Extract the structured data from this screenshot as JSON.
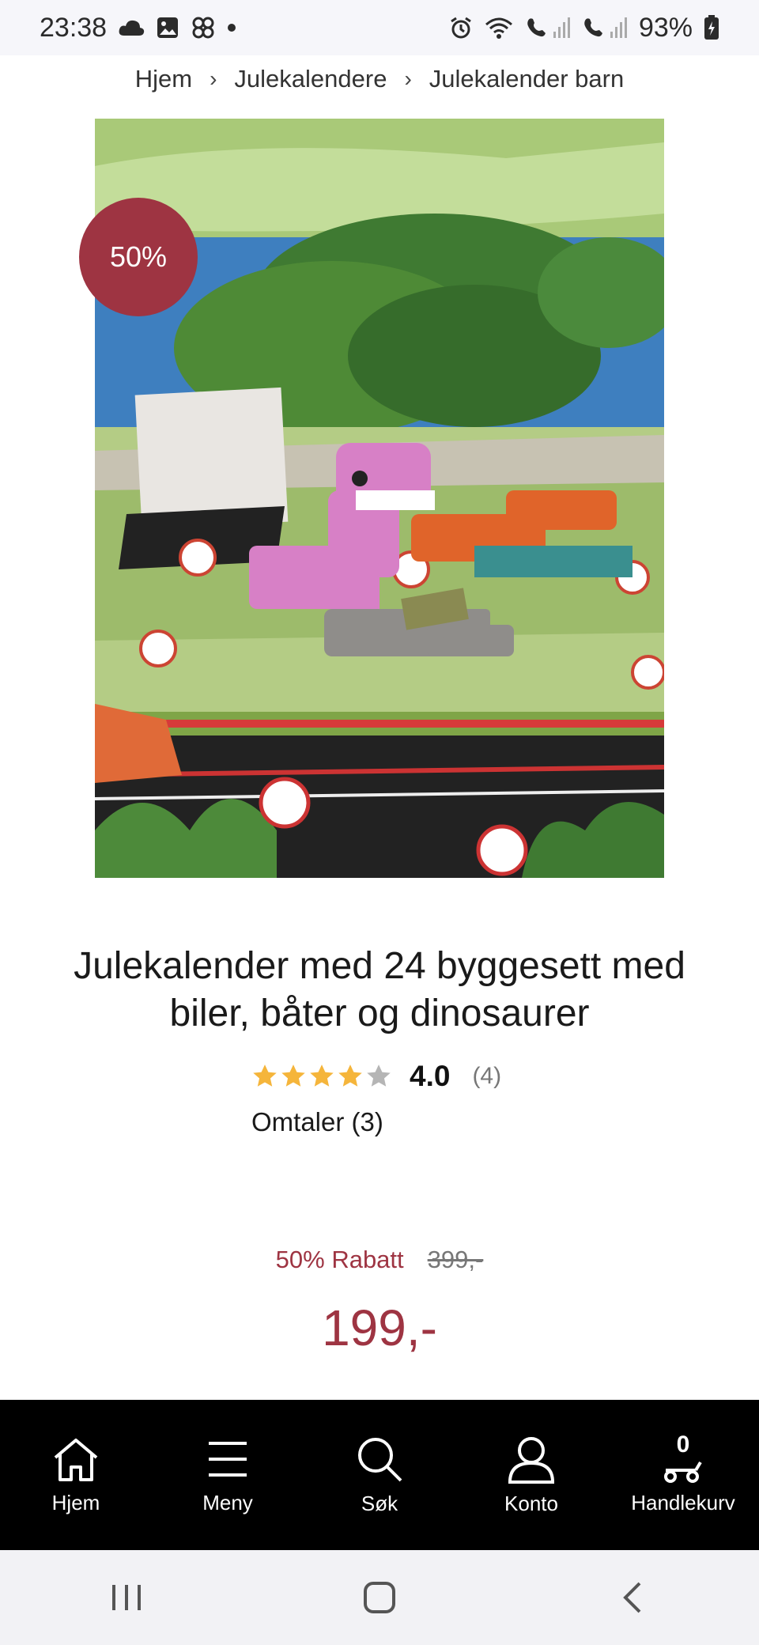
{
  "status_bar": {
    "time": "23:38",
    "battery": "93%"
  },
  "breadcrumb": [
    {
      "label": "Hjem"
    },
    {
      "label": "Julekalendere"
    },
    {
      "label": "Julekalender barn"
    }
  ],
  "product": {
    "badge": "50%",
    "title": "Julekalender med 24 byggesett med biler, båter og dinosaurer",
    "rating": "4.0",
    "rating_value": 4,
    "rating_count": "(4)",
    "reviews_link": "Omtaler (3)",
    "discount_label": "50% Rabatt",
    "old_price": "399,-",
    "price": "199,-",
    "image_icon": "lego-dinosaur-advent-calendar-photo"
  },
  "bottom_nav": {
    "items": [
      {
        "label": "Hjem",
        "icon": "home-icon"
      },
      {
        "label": "Meny",
        "icon": "menu-icon"
      },
      {
        "label": "Søk",
        "icon": "search-icon"
      },
      {
        "label": "Konto",
        "icon": "user-icon"
      },
      {
        "label": "Handlekurv",
        "icon": "cart-icon"
      }
    ],
    "cart_count": "0"
  },
  "colors": {
    "accent": "#9e3442",
    "star": "#f5b53b",
    "nav_bg": "#000000"
  }
}
